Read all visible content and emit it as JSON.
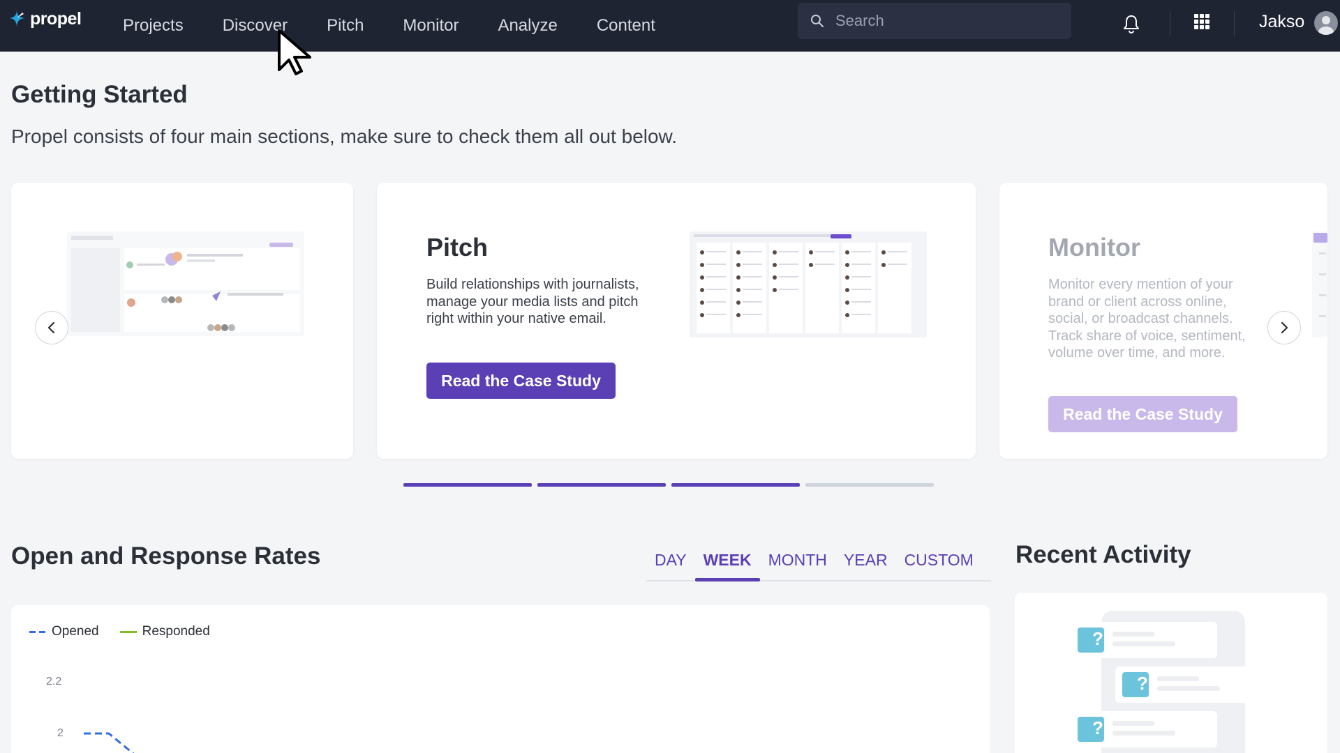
{
  "nav": {
    "brand": "propel",
    "items": [
      "Projects",
      "Discover",
      "Pitch",
      "Monitor",
      "Analyze",
      "Content"
    ],
    "search_placeholder": "Search",
    "user_name": "Jakso"
  },
  "getting_started": {
    "title": "Getting Started",
    "subtitle": "Propel consists of four main sections, make sure to check them all out below."
  },
  "carousel": {
    "active": {
      "title": "Pitch",
      "text": "Build relationships with journalists, manage your media lists and pitch right within your native email.",
      "cta": "Read the Case Study"
    },
    "next": {
      "title": "Monitor",
      "text": "Monitor every mention of your brand or client across online, social, or broadcast channels. Track share of voice, sentiment, volume over time, and more.",
      "cta": "Read the Case Study"
    },
    "indicator_states": [
      "filled",
      "filled",
      "filled",
      "empty"
    ],
    "colors": {
      "accent": "#5b3fb5",
      "accent_light": "#c9b9ea",
      "inactive": "#cfd3db"
    }
  },
  "rates": {
    "title": "Open and Response Rates",
    "tabs": [
      "DAY",
      "WEEK",
      "MONTH",
      "YEAR",
      "CUSTOM"
    ],
    "active_tab": "WEEK"
  },
  "chart_data": {
    "type": "line",
    "series": [
      {
        "name": "Opened",
        "values": [
          2,
          2,
          1.92
        ],
        "color": "#2f6fe0",
        "style": "dashed"
      },
      {
        "name": "Responded",
        "values": [],
        "color": "#7dbb2f",
        "style": "solid"
      }
    ],
    "y_ticks": [
      2.2,
      2
    ],
    "ylim": [
      1.9,
      2.3
    ]
  },
  "activity": {
    "title": "Recent Activity",
    "placeholder_glyph": "?"
  }
}
